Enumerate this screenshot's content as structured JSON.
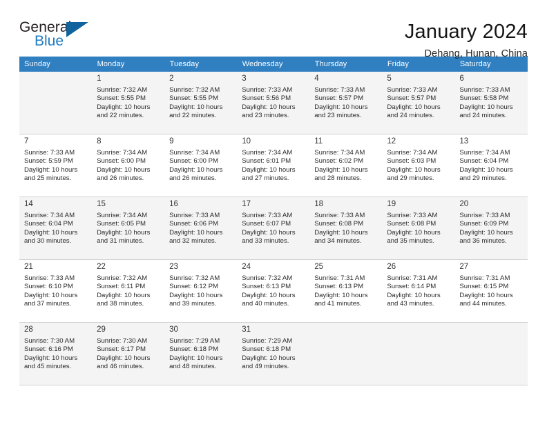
{
  "brand": {
    "word_one": "General",
    "word_two": "Blue",
    "triangle_icon": "triangle-icon",
    "accent_blue": "#1f7ac0",
    "accent_dark_blue": "#11639e"
  },
  "header": {
    "title": "January 2024",
    "location": "Dehang, Hunan, China"
  },
  "calendar": {
    "header_bg": "#2f7fc1",
    "weekday_headers": [
      "Sunday",
      "Monday",
      "Tuesday",
      "Wednesday",
      "Thursday",
      "Friday",
      "Saturday"
    ],
    "weeks": [
      [
        {
          "day": "",
          "detail": ""
        },
        {
          "day": "1",
          "detail": "Sunrise: 7:32 AM\nSunset: 5:55 PM\nDaylight: 10 hours\nand 22 minutes."
        },
        {
          "day": "2",
          "detail": "Sunrise: 7:32 AM\nSunset: 5:55 PM\nDaylight: 10 hours\nand 22 minutes."
        },
        {
          "day": "3",
          "detail": "Sunrise: 7:33 AM\nSunset: 5:56 PM\nDaylight: 10 hours\nand 23 minutes."
        },
        {
          "day": "4",
          "detail": "Sunrise: 7:33 AM\nSunset: 5:57 PM\nDaylight: 10 hours\nand 23 minutes."
        },
        {
          "day": "5",
          "detail": "Sunrise: 7:33 AM\nSunset: 5:57 PM\nDaylight: 10 hours\nand 24 minutes."
        },
        {
          "day": "6",
          "detail": "Sunrise: 7:33 AM\nSunset: 5:58 PM\nDaylight: 10 hours\nand 24 minutes."
        }
      ],
      [
        {
          "day": "7",
          "detail": "Sunrise: 7:33 AM\nSunset: 5:59 PM\nDaylight: 10 hours\nand 25 minutes."
        },
        {
          "day": "8",
          "detail": "Sunrise: 7:34 AM\nSunset: 6:00 PM\nDaylight: 10 hours\nand 26 minutes."
        },
        {
          "day": "9",
          "detail": "Sunrise: 7:34 AM\nSunset: 6:00 PM\nDaylight: 10 hours\nand 26 minutes."
        },
        {
          "day": "10",
          "detail": "Sunrise: 7:34 AM\nSunset: 6:01 PM\nDaylight: 10 hours\nand 27 minutes."
        },
        {
          "day": "11",
          "detail": "Sunrise: 7:34 AM\nSunset: 6:02 PM\nDaylight: 10 hours\nand 28 minutes."
        },
        {
          "day": "12",
          "detail": "Sunrise: 7:34 AM\nSunset: 6:03 PM\nDaylight: 10 hours\nand 29 minutes."
        },
        {
          "day": "13",
          "detail": "Sunrise: 7:34 AM\nSunset: 6:04 PM\nDaylight: 10 hours\nand 29 minutes."
        }
      ],
      [
        {
          "day": "14",
          "detail": "Sunrise: 7:34 AM\nSunset: 6:04 PM\nDaylight: 10 hours\nand 30 minutes."
        },
        {
          "day": "15",
          "detail": "Sunrise: 7:34 AM\nSunset: 6:05 PM\nDaylight: 10 hours\nand 31 minutes."
        },
        {
          "day": "16",
          "detail": "Sunrise: 7:33 AM\nSunset: 6:06 PM\nDaylight: 10 hours\nand 32 minutes."
        },
        {
          "day": "17",
          "detail": "Sunrise: 7:33 AM\nSunset: 6:07 PM\nDaylight: 10 hours\nand 33 minutes."
        },
        {
          "day": "18",
          "detail": "Sunrise: 7:33 AM\nSunset: 6:08 PM\nDaylight: 10 hours\nand 34 minutes."
        },
        {
          "day": "19",
          "detail": "Sunrise: 7:33 AM\nSunset: 6:08 PM\nDaylight: 10 hours\nand 35 minutes."
        },
        {
          "day": "20",
          "detail": "Sunrise: 7:33 AM\nSunset: 6:09 PM\nDaylight: 10 hours\nand 36 minutes."
        }
      ],
      [
        {
          "day": "21",
          "detail": "Sunrise: 7:33 AM\nSunset: 6:10 PM\nDaylight: 10 hours\nand 37 minutes."
        },
        {
          "day": "22",
          "detail": "Sunrise: 7:32 AM\nSunset: 6:11 PM\nDaylight: 10 hours\nand 38 minutes."
        },
        {
          "day": "23",
          "detail": "Sunrise: 7:32 AM\nSunset: 6:12 PM\nDaylight: 10 hours\nand 39 minutes."
        },
        {
          "day": "24",
          "detail": "Sunrise: 7:32 AM\nSunset: 6:13 PM\nDaylight: 10 hours\nand 40 minutes."
        },
        {
          "day": "25",
          "detail": "Sunrise: 7:31 AM\nSunset: 6:13 PM\nDaylight: 10 hours\nand 41 minutes."
        },
        {
          "day": "26",
          "detail": "Sunrise: 7:31 AM\nSunset: 6:14 PM\nDaylight: 10 hours\nand 43 minutes."
        },
        {
          "day": "27",
          "detail": "Sunrise: 7:31 AM\nSunset: 6:15 PM\nDaylight: 10 hours\nand 44 minutes."
        }
      ],
      [
        {
          "day": "28",
          "detail": "Sunrise: 7:30 AM\nSunset: 6:16 PM\nDaylight: 10 hours\nand 45 minutes."
        },
        {
          "day": "29",
          "detail": "Sunrise: 7:30 AM\nSunset: 6:17 PM\nDaylight: 10 hours\nand 46 minutes."
        },
        {
          "day": "30",
          "detail": "Sunrise: 7:29 AM\nSunset: 6:18 PM\nDaylight: 10 hours\nand 48 minutes."
        },
        {
          "day": "31",
          "detail": "Sunrise: 7:29 AM\nSunset: 6:18 PM\nDaylight: 10 hours\nand 49 minutes."
        },
        {
          "day": "",
          "detail": ""
        },
        {
          "day": "",
          "detail": ""
        },
        {
          "day": "",
          "detail": ""
        }
      ]
    ]
  }
}
